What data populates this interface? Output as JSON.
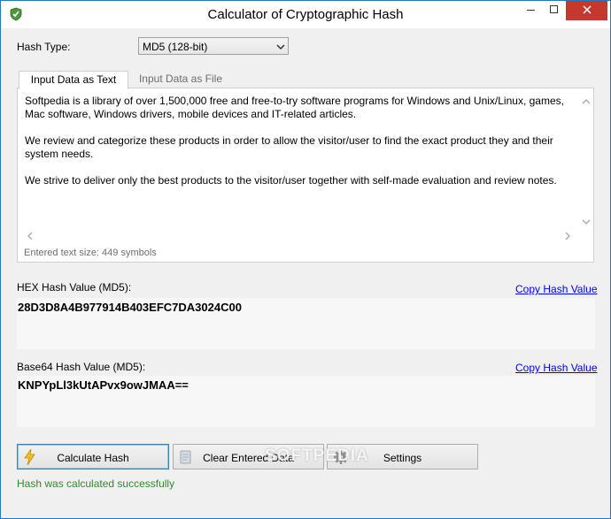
{
  "window": {
    "title": "Calculator of Cryptographic Hash",
    "app_icon": "shield-check-icon"
  },
  "titlebar_buttons": [
    "minimize-icon",
    "maximize-icon",
    "close-icon"
  ],
  "hash_type": {
    "label": "Hash Type:",
    "selected": "MD5 (128-bit)"
  },
  "tabs": [
    {
      "label": "Input Data as Text",
      "active": true
    },
    {
      "label": "Input Data as File",
      "active": false
    }
  ],
  "input": {
    "paragraphs": [
      "Softpedia is a library of over 1,500,000 free and free-to-try software programs for Windows and Unix/Linux, games, Mac software, Windows drivers, mobile devices and IT-related articles.",
      "We review and categorize these products in order to allow the visitor/user to find the exact product they and their system needs.",
      "We strive to deliver only the best products to the visitor/user together with self-made evaluation and review notes."
    ],
    "size_text": "Entered text size: 449 symbols"
  },
  "hex": {
    "label": "HEX Hash Value (MD5):",
    "value": "28D3D8A4B977914B403EFC7DA3024C00",
    "copy_label": "Copy Hash Value"
  },
  "base64": {
    "label": "Base64 Hash Value (MD5):",
    "value": "KNPYpLl3kUtAPvx9owJMAA==",
    "copy_label": "Copy Hash Value"
  },
  "buttons": {
    "calculate": "Calculate Hash",
    "clear": "Clear Entered Data",
    "settings": "Settings"
  },
  "status": "Hash was calculated successfully",
  "watermark": "SOFTPEDIA",
  "colors": {
    "accent_border": "#1e77c9",
    "close_button": "#c7372f",
    "link": "#0000ee",
    "status_ok": "#2d8a2d"
  }
}
